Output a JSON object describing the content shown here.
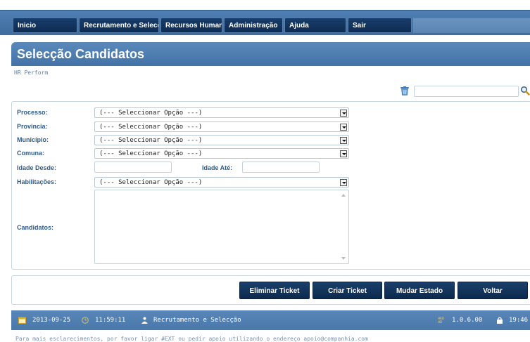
{
  "nav": {
    "items": [
      {
        "label": "Inicio"
      },
      {
        "label": "Recrutamento e Selecção"
      },
      {
        "label": "Recursos Humanos"
      },
      {
        "label": "Administração"
      },
      {
        "label": "Ajuda"
      },
      {
        "label": "Sair"
      }
    ]
  },
  "page": {
    "title": "Selecção Candidatos",
    "breadcrumb": "HR Perform"
  },
  "search": {
    "value": "",
    "placeholder": ""
  },
  "form": {
    "processo_label": "Processo:",
    "provincia_label": "Provincia:",
    "municipio_label": "Município:",
    "comuna_label": "Comuna:",
    "idade_desde_label": "Idade Desde:",
    "idade_ate_label": "Idade Até:",
    "habilitacoes_label": "Habilitações:",
    "candidatos_label": "Candidatos:",
    "select_placeholder": "(--- Seleccionar Opção ---)"
  },
  "buttons": {
    "eliminar": "Eliminar Ticket",
    "criar": "Criar Ticket",
    "mudar": "Mudar Estado",
    "voltar": "Voltar"
  },
  "status": {
    "date": "2013-09-25",
    "time": "11:59:11",
    "module": "Recrutamento e Selecção",
    "version": "1.0.6.00",
    "session_time": "19:46"
  },
  "footer": {
    "text": "Para mais esclarecimentos, por favor ligar #EXT ou pedir apoio utilizando o endereço apoio@companhia.com"
  },
  "colors": {
    "nav_bg": "#4f7fb3",
    "nav_button": "#173d6b",
    "title_bg": "#4a7bb0",
    "label": "#2f5d92",
    "status_bg": "#5886b8"
  }
}
